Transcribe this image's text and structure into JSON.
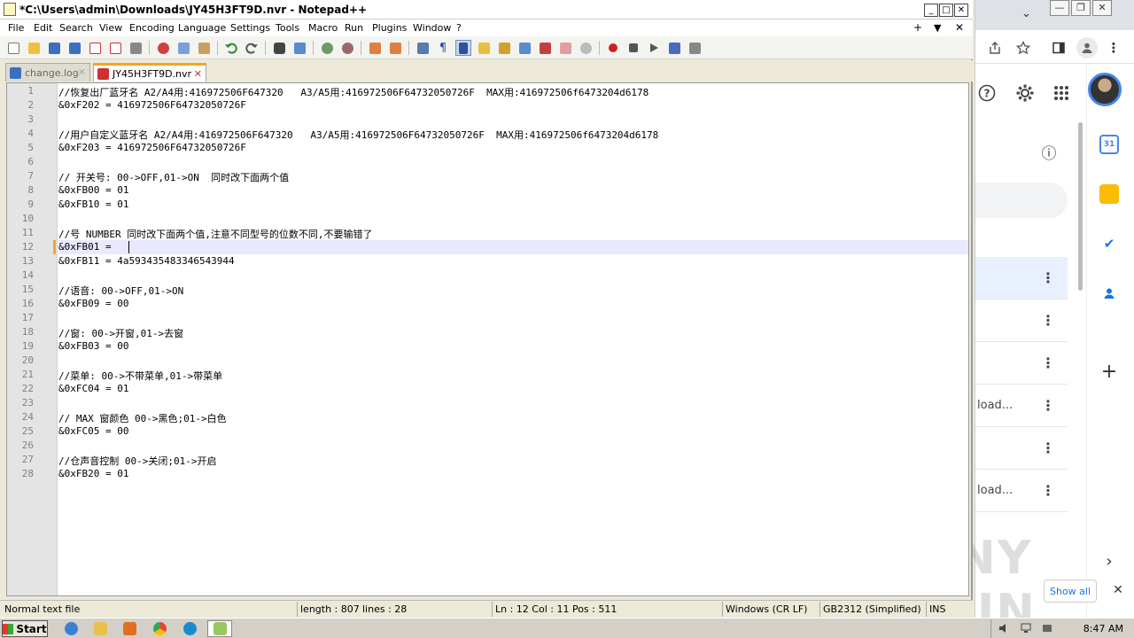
{
  "window": {
    "title": "*C:\\Users\\admin\\Downloads\\JY45H3FT9D.nvr - Notepad++",
    "minimize": "_",
    "maximize": "□",
    "close": "✕"
  },
  "menu": [
    "File",
    "Edit",
    "Search",
    "View",
    "Encoding",
    "Language",
    "Settings",
    "Tools",
    "Macro",
    "Run",
    "Plugins",
    "Window",
    "?"
  ],
  "menu_right": {
    "add": "+",
    "dropdown": "▼",
    "close": "✕"
  },
  "tabs": [
    {
      "label": "change.log",
      "active": false,
      "close": "✕"
    },
    {
      "label": "JY45H3FT9D.nvr",
      "active": true,
      "close": "✕"
    }
  ],
  "editor": {
    "lines": [
      "//恢复出厂蓝牙名 A2/A4用:416972506F647320   A3/A5用:416972506F64732050726F  MAX用:416972506f6473204d6178",
      "&0xF202 = 416972506F64732050726F",
      "",
      "//用户自定义蓝牙名 A2/A4用:416972506F647320   A3/A5用:416972506F64732050726F  MAX用:416972506f6473204d6178",
      "&0xF203 = 416972506F64732050726F",
      "",
      "// 开关号: 00->OFF,01->ON  同时改下面两个值",
      "&0xFB00 = 01",
      "&0xFB10 = 01",
      "",
      "//号 NUMBER 同时改下面两个值,注意不同型号的位数不同,不要输错了",
      "&0xFB01 = ",
      "&0xFB11 = 4a593435483346543944",
      "",
      "//语音: 00->OFF,01->ON",
      "&0xFB09 = 00",
      "",
      "//窗: 00->开窗,01->去窗",
      "&0xFB03 = 00",
      "",
      "//菜单: 00->不带菜单,01->带菜单",
      "&0xFC04 = 01",
      "",
      "// MAX 窗颜色 00->黑色;01->白色",
      "&0xFC05 = 00",
      "",
      "//仓声音控制 00->关闭;01->开启",
      "&0xFB20 = 01"
    ],
    "line_numbers": [
      "1",
      "2",
      "3",
      "4",
      "5",
      "6",
      "7",
      "8",
      "9",
      "10",
      "11",
      "12",
      "13",
      "14",
      "15",
      "16",
      "17",
      "18",
      "19",
      "20",
      "21",
      "22",
      "23",
      "24",
      "25",
      "26",
      "27",
      "28"
    ]
  },
  "status": {
    "filetype": "Normal text file",
    "length": "length : 807",
    "lines": "lines : 28",
    "position": "Ln : 12    Col : 11    Pos : 511",
    "eol": "Windows (CR LF)",
    "encoding": "GB2312 (Simplified)",
    "mode": "INS"
  },
  "chrome": {
    "tab_chevron": "⌄",
    "win_min": "—",
    "win_max": "❐",
    "win_close": "✕",
    "rows": [
      "",
      "",
      "",
      "load...",
      "",
      "load...",
      ""
    ],
    "kebab": "⋮",
    "add": "+",
    "expand": "›",
    "show_all": "Show all",
    "close_download": "✕",
    "info": "ⓘ",
    "watermark": "ANY RUN"
  },
  "taskbar": {
    "start": "Start",
    "clock": "8:47 AM"
  },
  "colors": {
    "tab_active_accent": "#f5a623",
    "current_line": "#e8e8ff",
    "chrome_accent": "#1a73e8"
  }
}
